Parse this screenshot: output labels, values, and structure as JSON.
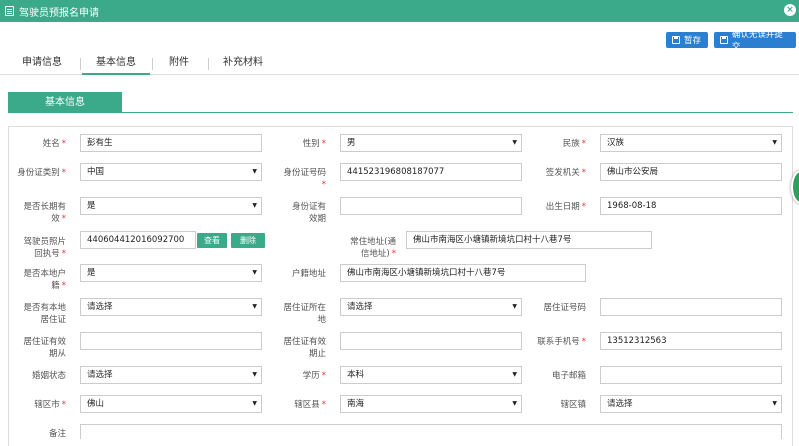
{
  "window": {
    "title": "驾驶员预报名申请"
  },
  "actions": {
    "save": "暂存",
    "submit": "确认无误并提交"
  },
  "tabs": [
    "申请信息",
    "基本信息",
    "附件",
    "补充材料"
  ],
  "section": {
    "title": "基本信息"
  },
  "form": {
    "name_label": "姓名",
    "name": "彭有生",
    "gender_label": "性别",
    "gender": "男",
    "ethnic_label": "民族",
    "ethnic": "汉族",
    "idtype_label": "身份证类别",
    "idtype": "中国",
    "idno_label": "身份证号码",
    "idno": "441523196808187077",
    "issuer_label": "签发机关",
    "issuer": "佛山市公安局",
    "longterm_label1": "是否长期有",
    "longterm_label2": "效",
    "longterm": "是",
    "idvalid_label1": "身份证有",
    "idvalid_label2": "效期",
    "idvalid": "",
    "birth_label": "出生日期",
    "birth": "1968-08-18",
    "receipt_label1": "驾驶员照片",
    "receipt_label2": "回执号",
    "receipt": "440604412016092700",
    "view_btn": "查看",
    "delete_btn": "删除",
    "addr_label1": "常住地址(通",
    "addr_label2": "信地址)",
    "addr": "佛山市南海区小塘镇新境坑口村十八巷7号",
    "localhukou_label1": "是否本地户",
    "localhukou_label2": "籍",
    "localhukou": "是",
    "hukouaddr_label": "户籍地址",
    "hukouaddr": "佛山市南海区小塘镇新境坑口村十八巷7号",
    "localres_label1": "是否有本地",
    "localres_label2": "居住证",
    "localres": "请选择",
    "resplace_label1": "居住证所在",
    "resplace_label2": "地",
    "resplace": "请选择",
    "resno_label": "居住证号码",
    "resno": "",
    "resfrom_label1": "居住证有效",
    "resfrom_label2": "期从",
    "resfrom": "",
    "resto_label1": "居住证有效",
    "resto_label2": "期止",
    "resto": "",
    "phone_label": "联系手机号",
    "phone": "13512312563",
    "marital_label": "婚姻状态",
    "marital": "请选择",
    "edu_label": "学历",
    "edu": "本科",
    "email_label": "电子邮箱",
    "email": "",
    "city_label": "辖区市",
    "city": "佛山",
    "county_label": "辖区县",
    "county": "南海",
    "town_label": "辖区镇",
    "town": "请选择",
    "note_label": "备注",
    "note": ""
  }
}
